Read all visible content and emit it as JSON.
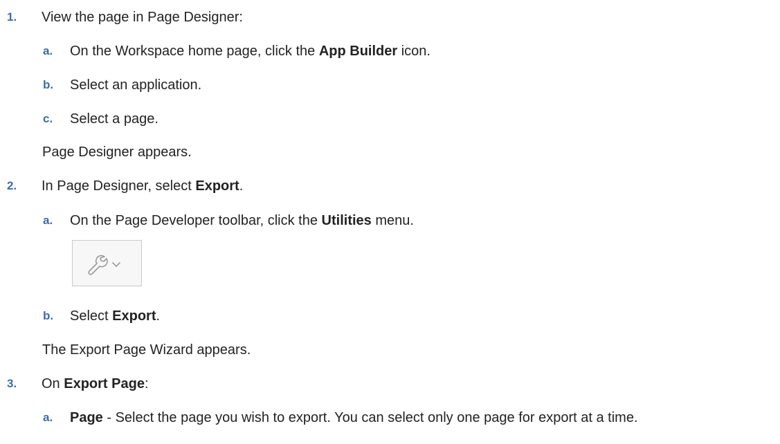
{
  "steps": [
    {
      "number": "1.",
      "text": "View the page in Page Designer:",
      "substeps": [
        {
          "letter": "a.",
          "pre": "On the Workspace home page, click the ",
          "bold": "App Builder",
          "post": " icon."
        },
        {
          "letter": "b.",
          "text": "Select an application."
        },
        {
          "letter": "c.",
          "text": "Select a page."
        }
      ],
      "result": "Page Designer appears."
    },
    {
      "number": "2.",
      "pre": "In Page Designer, select ",
      "bold": "Export",
      "post": ".",
      "substeps": [
        {
          "letter": "a.",
          "pre": "On the Page Developer toolbar, click the ",
          "bold": "Utilities",
          "post": " menu."
        },
        {
          "letter": "b.",
          "pre": "Select ",
          "bold": "Export",
          "post": "."
        }
      ],
      "result": "The Export Page Wizard appears."
    },
    {
      "number": "3.",
      "pre": "On ",
      "bold": "Export Page",
      "post": ":",
      "substeps": [
        {
          "letter": "a.",
          "bold": "Page",
          "post": " - Select the page you wish to export. You can select only one page for export at a time."
        }
      ]
    }
  ],
  "toolbar_image": {
    "icons": [
      "wrench-icon",
      "chevron-down-icon"
    ],
    "colors": {
      "border": "#c9c9c9",
      "background": "#f7f7f7",
      "icon": "#9a9a9a"
    }
  },
  "colors": {
    "numbering": "#3a6ea5",
    "text": "#222222"
  }
}
